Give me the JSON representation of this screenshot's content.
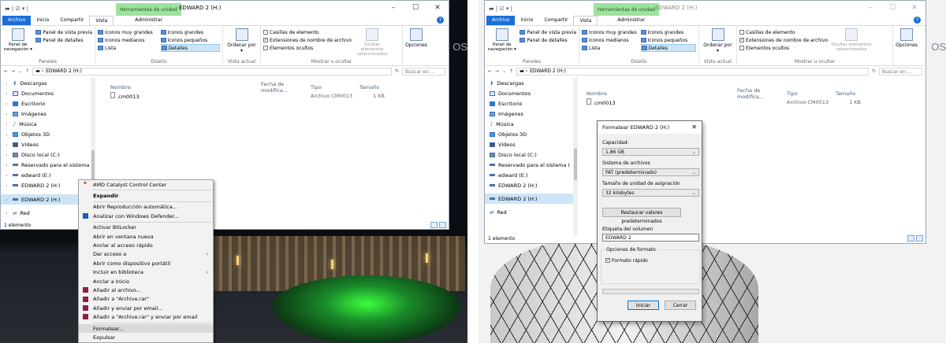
{
  "left": {
    "qat": "▬ | ☑ ▾ |",
    "context_tab": "Herramientas de unidad",
    "window_title": "EDWARD 2 (H:)",
    "window_controls": [
      "–",
      "☐",
      "✕"
    ],
    "tabs": [
      "Archivo",
      "Inicio",
      "Compartir",
      "Vista",
      "Administrar"
    ],
    "ribbon": {
      "paneles": {
        "nav_pane": "Panel de navegación ▾",
        "preview": "Panel de vista previa",
        "details": "Panel de detalles",
        "label": "Paneles"
      },
      "diseno": {
        "items": [
          "Iconos muy grandes",
          "Iconos grandes",
          "Iconos medianos",
          "Iconos pequeños",
          "Lista",
          "Detalles"
        ],
        "label": "Diseño"
      },
      "vista_actual": {
        "sort": "Ordenar por ▾",
        "label": "Vista actual"
      },
      "mostrar": {
        "checkboxes": [
          "Casillas de elemento",
          "Extensiones de nombre de archivo",
          "Elementos ocultos"
        ],
        "hide": "Ocultar elementos seleccionados",
        "label": "Mostrar u ocultar"
      },
      "opciones": "Opciones"
    },
    "address": "EDWARD 2 (H:)",
    "search_placeholder": "Buscar en ...",
    "nav_items": [
      "Descargas",
      "Documentos",
      "Escritorio",
      "Imágenes",
      "Música",
      "Objetos 3D",
      "Vídeos",
      "Disco local (C:)",
      "Reservado para el sistema (",
      "edward (E:)",
      "EDWARD 2 (H:)",
      "EDWARD 2 (H:)",
      "Red"
    ],
    "columns": [
      "Nombre",
      "Fecha de modifica...",
      "Tipo",
      "Tamaño"
    ],
    "file": {
      "name": ".cm0013",
      "type": "Archivo CM0013",
      "size": "1 KB"
    },
    "status": "1 elemento",
    "context_menu": [
      "AMD Catalyst Control Center",
      "Expandir",
      "Abrir Reproducción automática...",
      "Analizar con Windows Defender...",
      "Activar BitLocker",
      "Abrir en ventana nueva",
      "Anclar al acceso rápido",
      "Dar acceso a",
      "Abrir como dispositivo portátil",
      "Incluir en biblioteca",
      "Anclar a Inicio",
      "Añadir al archivo...",
      "Añadir a \"Archive.rar\"",
      "Añadir y enviar por email...",
      "Añadir a \"Archive.rar\" y enviar por email",
      "Formatear...",
      "Expulsar"
    ]
  },
  "right": {
    "context_tab": "Herramientas de unidad",
    "window_title": "EDWARD 2 (H:)",
    "tabs": [
      "Archivo",
      "Inicio",
      "Compartir",
      "Vista",
      "Administrar"
    ],
    "address": "EDWARD 2 (H:)",
    "search_placeholder": "Buscar en ...",
    "nav_items": [
      "Descargas",
      "Documentos",
      "Escritorio",
      "Imágenes",
      "Música",
      "Objetos 3D",
      "Vídeos",
      "Disco local (C:)",
      "Reservado para el sistema (",
      "edward (E:)",
      "EDWARD 2 (H:)",
      "Red"
    ],
    "status": "1 elemento",
    "dialog": {
      "title": "Formatear EDWARD 2 (H:)",
      "capacity_label": "Capacidad:",
      "capacity": "1,86 GB",
      "fs_label": "Sistema de archivos",
      "fs": "FAT (predeterminado)",
      "alloc_label": "Tamaño de unidad de asignación",
      "alloc": "32 kilobytes",
      "restore": "Restaurar valores predeterminados",
      "vol_label": "Etiqueta del volumen",
      "vol": "EDWARD 2",
      "options_label": "Opciones de formato",
      "quick": "Formato rápido",
      "start": "Iniciar",
      "close": "Cerrar"
    }
  },
  "desktop_text": "OS"
}
